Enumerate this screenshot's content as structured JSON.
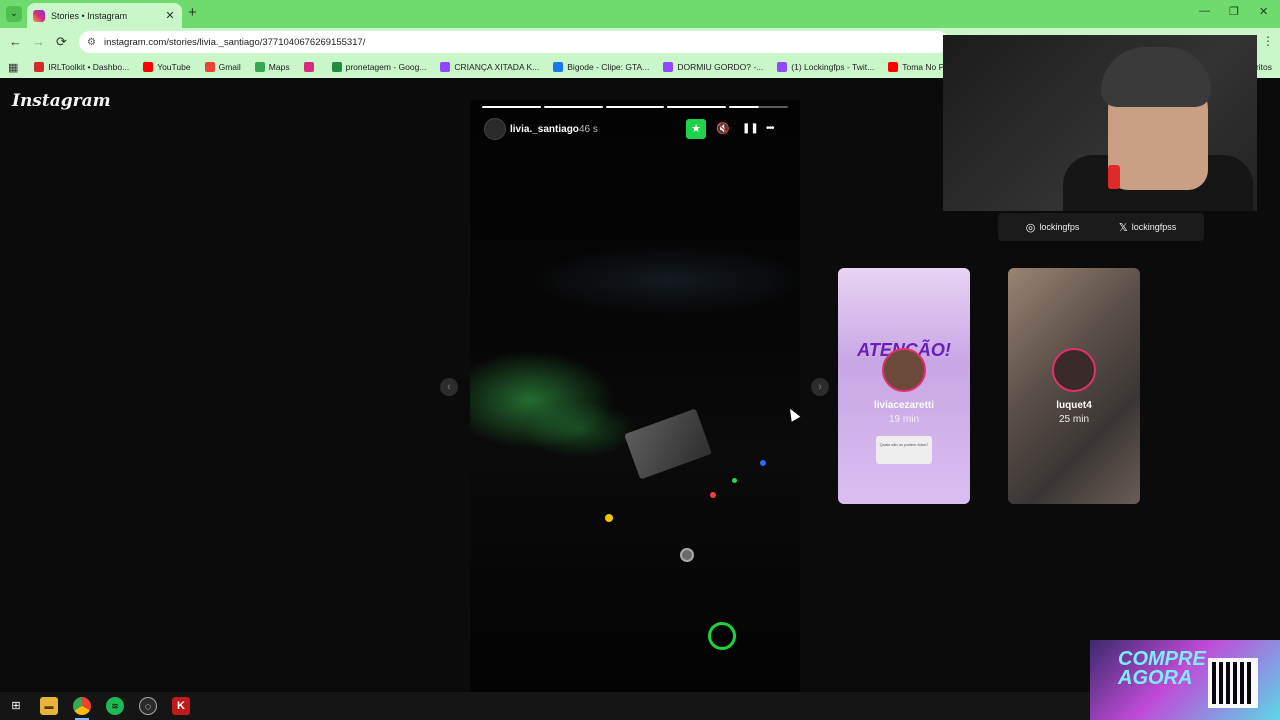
{
  "browser": {
    "tab": {
      "title": "Stories • Instagram",
      "close": "✕"
    },
    "new_tab": "+",
    "window_controls": {
      "minimize": "—",
      "restore": "❐",
      "close": "✕"
    },
    "nav": {
      "back": "←",
      "forward": "→",
      "reload": "⟳"
    },
    "url": "instagram.com/stories/livia._santiago/3771040676269155317/",
    "menu": "⋮",
    "bookmarks": [
      {
        "label": "IRLToolkit • Dashbo...",
        "color": "#d12b2b"
      },
      {
        "label": "YouTube",
        "color": "#ff0000"
      },
      {
        "label": "Gmail",
        "color": "#ea4335"
      },
      {
        "label": "Maps",
        "color": "#34a853"
      },
      {
        "label": "",
        "color": "#d82b7e"
      },
      {
        "label": "pronetagem - Goog...",
        "color": "#1e8e3e"
      },
      {
        "label": "CRIANÇA XITADA K...",
        "color": "#9146ff"
      },
      {
        "label": "Bigode - Clipe: GTA...",
        "color": "#1877f2"
      },
      {
        "label": "DORMIU GORDO? -...",
        "color": "#9146ff"
      },
      {
        "label": "(1) Lockingfps - Twit...",
        "color": "#9146ff"
      },
      {
        "label": "Toma No Pirikito, Q...",
        "color": "#ff0000"
      }
    ],
    "bookmarks_more": "ritos"
  },
  "instagram": {
    "logo": "Instagram",
    "story": {
      "username": "livia._santiago",
      "time": "46 s",
      "progress_segments": [
        1,
        1,
        1,
        1,
        0.5
      ],
      "fav_icon": "★",
      "mute_icon": "🔇",
      "pause_icon": "❚❚",
      "more_icon": "•••"
    },
    "nav": {
      "prev": "‹",
      "next": "›"
    },
    "previews": [
      {
        "username": "liviacezaretti",
        "time": "19 min",
        "headline": "ATENÇÃO!",
        "box": "Quais são os podem fotos?"
      },
      {
        "username": "luquet4",
        "time": "25 min"
      }
    ]
  },
  "overlay": {
    "socials": [
      {
        "icon": "◎",
        "handle": "lockingfps"
      },
      {
        "icon": "𝕏",
        "handle": "lockingfpss"
      }
    ],
    "ad_text": "COMPRE AGORA"
  },
  "taskbar": {
    "items": [
      "start",
      "explorer",
      "chrome",
      "spotify",
      "obs",
      "app"
    ]
  }
}
